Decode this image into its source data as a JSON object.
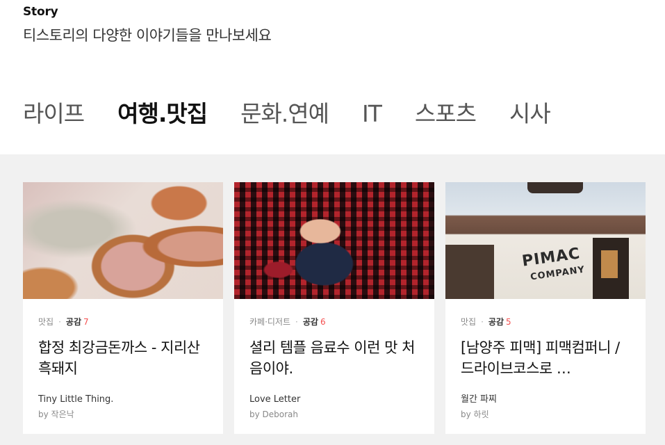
{
  "header": {
    "label": "Story",
    "subtitle": "티스토리의 다양한 이야기들을 만나보세요"
  },
  "tabs": [
    {
      "label": "라이프",
      "active": false
    },
    {
      "label": "여행.맛집",
      "active": true
    },
    {
      "label": "문화.연예",
      "active": false
    },
    {
      "label": "IT",
      "active": false
    },
    {
      "label": "스포츠",
      "active": false
    },
    {
      "label": "시사",
      "active": false
    }
  ],
  "colors": {
    "accent": "#f44f4f",
    "panel_bg": "#f1f1f1"
  },
  "cards": [
    {
      "category": "맛집",
      "likes_label": "공감",
      "likes_count": "7",
      "title": "합정 최강금돈까스 - 지리산 흑돼지",
      "blog": "Tiny Little Thing.",
      "author": "by 작은낙",
      "thumb_icon": "pork-cutlet-photo"
    },
    {
      "category": "카페·디저트",
      "likes_label": "공감",
      "likes_count": "6",
      "title": "셜리 템플 음료수 이런 맛 처음이야.",
      "blog": "Love Letter",
      "author": "by Deborah",
      "thumb_icon": "baby-drink-photo"
    },
    {
      "category": "맛집",
      "likes_label": "공감",
      "likes_count": "5",
      "title": "[남양주 피맥] 피맥컴퍼니 / 드라이브코스로 …",
      "blog": "월간 파찌",
      "author": "by 하릿",
      "thumb_icon": "restaurant-storefront-photo",
      "thumb_sign": "PIMAC",
      "thumb_sign2": "COMPANY"
    }
  ]
}
